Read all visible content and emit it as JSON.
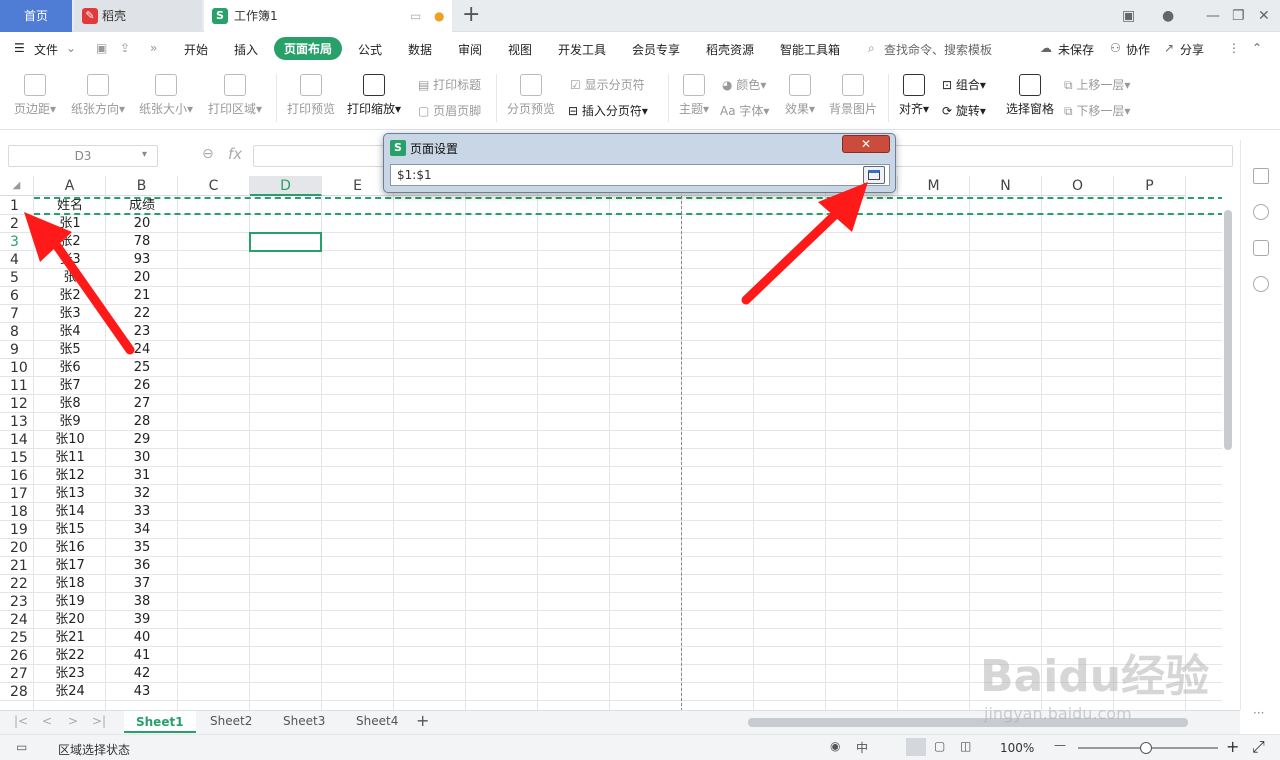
{
  "tabs": {
    "home": "首页",
    "daoke": "稻壳",
    "doc": "工作簿1"
  },
  "menu": {
    "file": "文件",
    "items": [
      "开始",
      "插入",
      "页面布局",
      "公式",
      "数据",
      "审阅",
      "视图",
      "开发工具",
      "会员专享",
      "稻壳资源",
      "智能工具箱"
    ],
    "search": "查找命令、搜索模板",
    "unsaved": "未保存",
    "collab": "协作",
    "share": "分享"
  },
  "ribbon": {
    "margin": "页边距",
    "orientation": "纸张方向",
    "size": "纸张大小",
    "print_area": "打印区域",
    "print_preview": "打印预览",
    "print_scale": "打印缩放",
    "print_titles": "打印标题",
    "header_footer": "页眉页脚",
    "page_break_preview": "分页预览",
    "show_page_breaks": "显示分页符",
    "insert_page_break": "插入分页符",
    "theme": "主题",
    "colors": "颜色",
    "fonts": "字体",
    "effects": "效果",
    "bg_image": "背景图片",
    "align": "对齐",
    "group": "组合",
    "rotate": "旋转",
    "select_pane": "选择窗格",
    "bring_forward": "上移一层",
    "send_backward": "下移一层"
  },
  "namebox": "D3",
  "fx": "fx",
  "columns": [
    "A",
    "B",
    "C",
    "D",
    "E",
    "",
    "",
    "",
    "",
    "",
    "",
    "",
    "M",
    "N",
    "O",
    "P"
  ],
  "rows": [
    {
      "n": "1",
      "a": "姓名",
      "b": "成绩"
    },
    {
      "n": "2",
      "a": "张1",
      "b": "20"
    },
    {
      "n": "3",
      "a": "张2",
      "b": "78"
    },
    {
      "n": "4",
      "a": "张3",
      "b": "93"
    },
    {
      "n": "5",
      "a": "张",
      "b": "20"
    },
    {
      "n": "6",
      "a": "张2",
      "b": "21"
    },
    {
      "n": "7",
      "a": "张3",
      "b": "22"
    },
    {
      "n": "8",
      "a": "张4",
      "b": "23"
    },
    {
      "n": "9",
      "a": "张5",
      "b": "24"
    },
    {
      "n": "10",
      "a": "张6",
      "b": "25"
    },
    {
      "n": "11",
      "a": "张7",
      "b": "26"
    },
    {
      "n": "12",
      "a": "张8",
      "b": "27"
    },
    {
      "n": "13",
      "a": "张9",
      "b": "28"
    },
    {
      "n": "14",
      "a": "张10",
      "b": "29"
    },
    {
      "n": "15",
      "a": "张11",
      "b": "30"
    },
    {
      "n": "16",
      "a": "张12",
      "b": "31"
    },
    {
      "n": "17",
      "a": "张13",
      "b": "32"
    },
    {
      "n": "18",
      "a": "张14",
      "b": "33"
    },
    {
      "n": "19",
      "a": "张15",
      "b": "34"
    },
    {
      "n": "20",
      "a": "张16",
      "b": "35"
    },
    {
      "n": "21",
      "a": "张17",
      "b": "36"
    },
    {
      "n": "22",
      "a": "张18",
      "b": "37"
    },
    {
      "n": "23",
      "a": "张19",
      "b": "38"
    },
    {
      "n": "24",
      "a": "张20",
      "b": "39"
    },
    {
      "n": "25",
      "a": "张21",
      "b": "40"
    },
    {
      "n": "26",
      "a": "张22",
      "b": "41"
    },
    {
      "n": "27",
      "a": "张23",
      "b": "42"
    },
    {
      "n": "28",
      "a": "张24",
      "b": "43"
    }
  ],
  "dialog": {
    "title": "页面设置",
    "value": "$1:$1"
  },
  "sheets": [
    "Sheet1",
    "Sheet2",
    "Sheet3",
    "Sheet4"
  ],
  "status": {
    "mode": "区域选择状态",
    "zoom": "100%"
  },
  "watermark": "Baidu经验 jingyan.baidu.com",
  "colors": {
    "accent": "#27a06a",
    "arrow": "#ff1a1a"
  }
}
